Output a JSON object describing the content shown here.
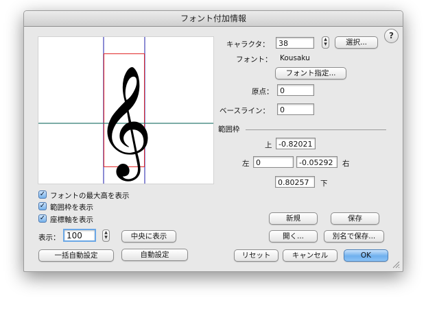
{
  "window": {
    "title": "フォント付加情報"
  },
  "help": {
    "label": "?"
  },
  "character": {
    "label": "キャラクタ：",
    "value": "38",
    "select_label": "選択..."
  },
  "font": {
    "label": "フォント：",
    "name": "Kousaku",
    "specify_label": "フォント指定..."
  },
  "origin": {
    "label": "原点：",
    "value": "0"
  },
  "baseline": {
    "label": "ベースライン：",
    "value": "0"
  },
  "bounds": {
    "section_label": "範囲枠",
    "top_label": "上",
    "top_value": "-0.82021",
    "left_label": "左",
    "left_value": "0",
    "right_label": "右",
    "right_value": "-0.05292",
    "bottom_label": "下",
    "bottom_value": "0.80257"
  },
  "preview": {
    "glyph": "𝄞"
  },
  "options": {
    "show_max_height": "フォントの最大高を表示",
    "show_bounds": "範囲枠を表示",
    "show_axes": "座標軸を表示"
  },
  "display": {
    "label": "表示：",
    "value": "100",
    "center_label": "中央に表示"
  },
  "buttons": {
    "new": "新規",
    "save": "保存",
    "open": "開く...",
    "save_as": "別名で保存...",
    "batch_auto": "一括自動設定",
    "auto": "自動設定",
    "reset": "リセット",
    "cancel": "キャンセル",
    "ok": "OK"
  },
  "colors": {
    "axis": "#2e7a72",
    "bounds": "#e02828",
    "max_height": "#1a1aa8",
    "default_button": "#6fb0ee"
  }
}
